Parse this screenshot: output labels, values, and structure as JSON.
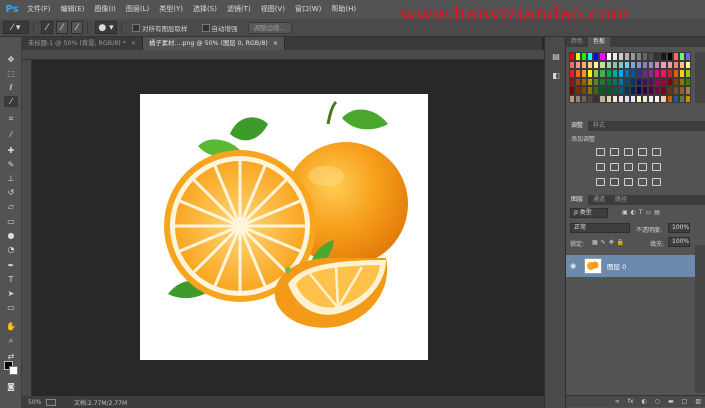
{
  "app": {
    "logo": "Ps"
  },
  "menu": [
    "文件(F)",
    "编辑(E)",
    "图像(I)",
    "图层(L)",
    "类型(Y)",
    "选择(S)",
    "滤镜(T)",
    "视图(V)",
    "窗口(W)",
    "帮助(H)"
  ],
  "watermark": "www.hanyiziandao.com",
  "options": {
    "sample_all_layers": "对所有图层取样",
    "auto_enhance": "自动增强",
    "refine_edge": "调整边缘..."
  },
  "tabs": [
    {
      "label": "未标题-1 @ 50% (背景, RGB/8) *",
      "close": "×"
    },
    {
      "label": "橘子素材....png @ 50% (图层 0, RGB/8)",
      "close": "×"
    }
  ],
  "status": {
    "zoom": "50%",
    "doc": "文档:2.77M/2.77M"
  },
  "icons": {
    "tools": [
      "move-icon",
      "marquee-icon",
      "lasso-icon",
      "quick-select-icon",
      "crop-icon",
      "eyedropper-icon",
      "healing-brush-icon",
      "brush-icon",
      "clone-stamp-icon",
      "history-brush-icon",
      "eraser-icon",
      "gradient-icon",
      "blur-icon",
      "dodge-icon",
      "pen-icon",
      "type-icon",
      "path-select-icon",
      "shape-icon",
      "hand-icon",
      "zoom-icon"
    ]
  },
  "panels": {
    "color_tabs": [
      "颜色",
      "色板"
    ],
    "adjust_tabs": [
      "调整",
      "样式"
    ],
    "adjust_title": "添加调整",
    "layer_tabs": [
      "图层",
      "通道",
      "路径"
    ],
    "kind": "ρ 类型",
    "blend_mode": "正常",
    "opacity_label": "不透明度:",
    "opacity_value": "100%",
    "lock_label": "锁定:",
    "fill_label": "填充:",
    "fill_value": "100%",
    "layer_name": "图层 0",
    "layer_bottom_icons": [
      "∞",
      "fx",
      "◐",
      "○",
      "▬",
      "□",
      "▥"
    ]
  },
  "colors": {
    "swatches": [
      "#ff0000",
      "#ffff00",
      "#00ff00",
      "#00ffff",
      "#0000ff",
      "#ff00ff",
      "#ffffff",
      "#e6e6e6",
      "#cccccc",
      "#b3b3b3",
      "#999999",
      "#808080",
      "#666666",
      "#4d4d4d",
      "#333333",
      "#1a1a1a",
      "#000000",
      "#ff6666",
      "#66ff66",
      "#6666ff",
      "#f26b5b",
      "#f7977a",
      "#fbad82",
      "#fdc68c",
      "#fff79a",
      "#c4df9b",
      "#a2d39c",
      "#82ca9d",
      "#7bcdc8",
      "#6ecff6",
      "#7ea7d8",
      "#8493ca",
      "#8882be",
      "#a187be",
      "#bc8dbf",
      "#f49ac2",
      "#f6989d",
      "#ff8080",
      "#ffbf80",
      "#ffff80",
      "#ed1c24",
      "#f26522",
      "#f7941d",
      "#fff200",
      "#8dc63f",
      "#39b54a",
      "#00a651",
      "#00a99d",
      "#00aeef",
      "#0072bc",
      "#0054a6",
      "#2e3192",
      "#662d91",
      "#92278f",
      "#ec008c",
      "#ed145b",
      "#c1272d",
      "#e65c00",
      "#ffcc00",
      "#99cc00",
      "#9e0b0f",
      "#a0410d",
      "#a36209",
      "#aba000",
      "#598527",
      "#1a7b30",
      "#007236",
      "#00746b",
      "#0076a3",
      "#004b80",
      "#003471",
      "#1b1464",
      "#440e62",
      "#630460",
      "#9e005d",
      "#9e0039",
      "#800000",
      "#804000",
      "#808000",
      "#408000",
      "#790000",
      "#7b2e00",
      "#7d4900",
      "#827b00",
      "#406618",
      "#005e20",
      "#005826",
      "#005952",
      "#005b7f",
      "#003663",
      "#002157",
      "#0d004c",
      "#32004b",
      "#4b0049",
      "#7b0046",
      "#7a0026",
      "#603913",
      "#754c24",
      "#8c6239",
      "#a67c52",
      "#c69c6d",
      "#998675",
      "#736357",
      "#534741",
      "#362f2d",
      "#c7b299",
      "#e0d4c0",
      "#fbe5d6",
      "#e7e6e6",
      "#d9e2f3",
      "#deeaf6",
      "#fff2cc",
      "#e2efd9",
      "#ededed",
      "#f2f2f2",
      "#f8cbad",
      "#c55a11",
      "#2f5597",
      "#548235",
      "#bf9000"
    ]
  }
}
